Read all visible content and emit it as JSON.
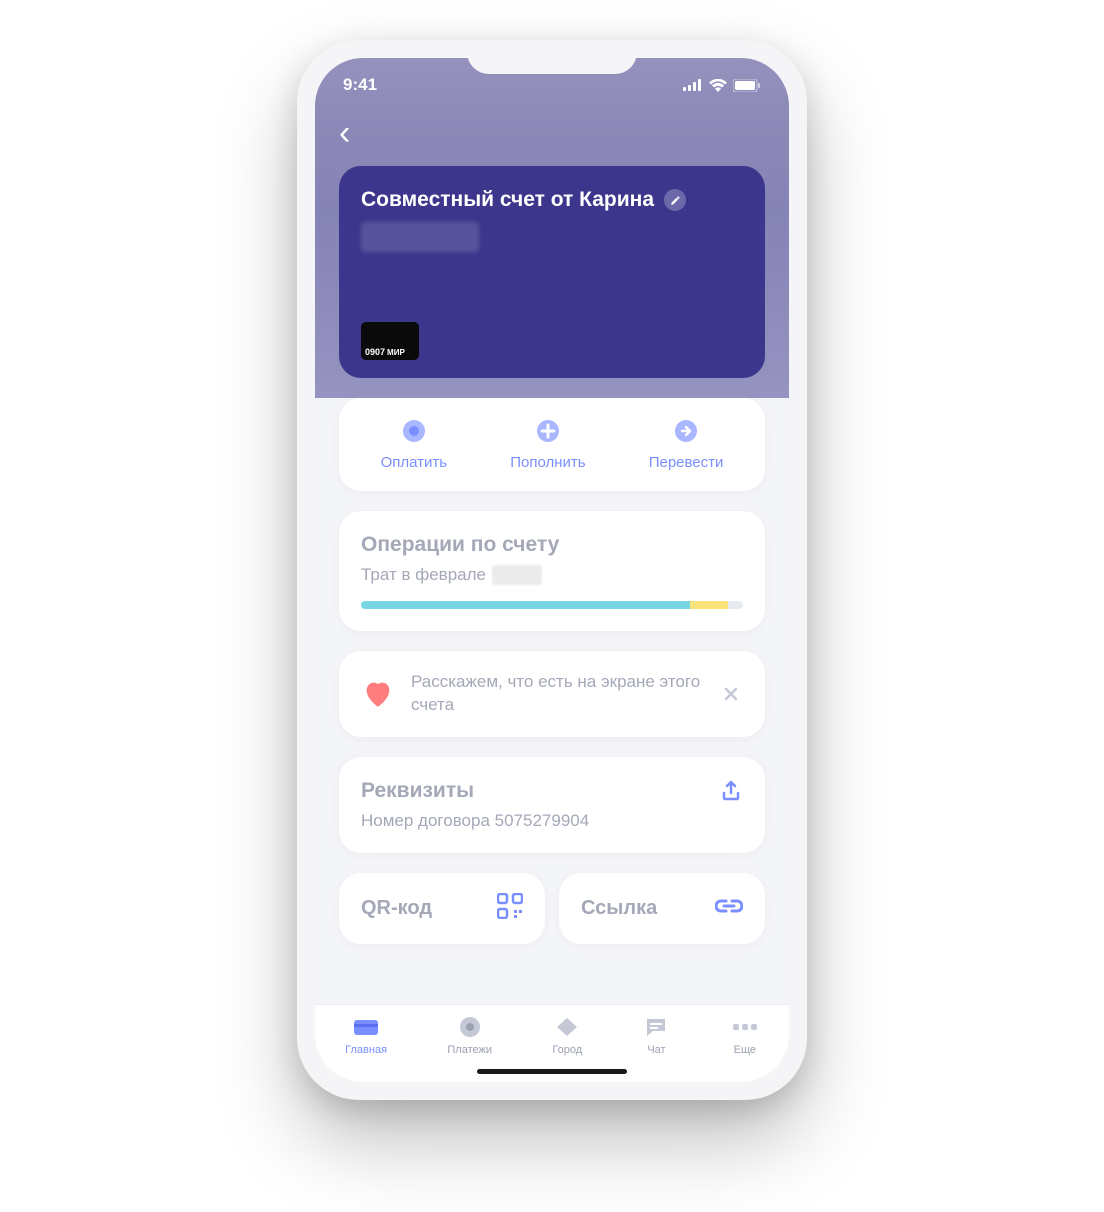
{
  "status": {
    "time": "9:41"
  },
  "account": {
    "title": "Совместный счет от Карина",
    "card_last4": "0907",
    "card_system": "МИР"
  },
  "actions": {
    "pay": "Оплатить",
    "topup": "Пополнить",
    "transfer": "Перевести"
  },
  "operations": {
    "title": "Операции по счету",
    "subtitle": "Трат в феврале"
  },
  "tip": {
    "text": "Расскажем, что есть на экране этого счета"
  },
  "details": {
    "title": "Реквизиты",
    "subtitle": "Номер договора 5075279904"
  },
  "qr": {
    "title": "QR-код"
  },
  "link": {
    "title": "Ссылка"
  },
  "nav": {
    "home": "Главная",
    "payments": "Платежи",
    "city": "Город",
    "chat": "Чат",
    "more": "Еще"
  }
}
